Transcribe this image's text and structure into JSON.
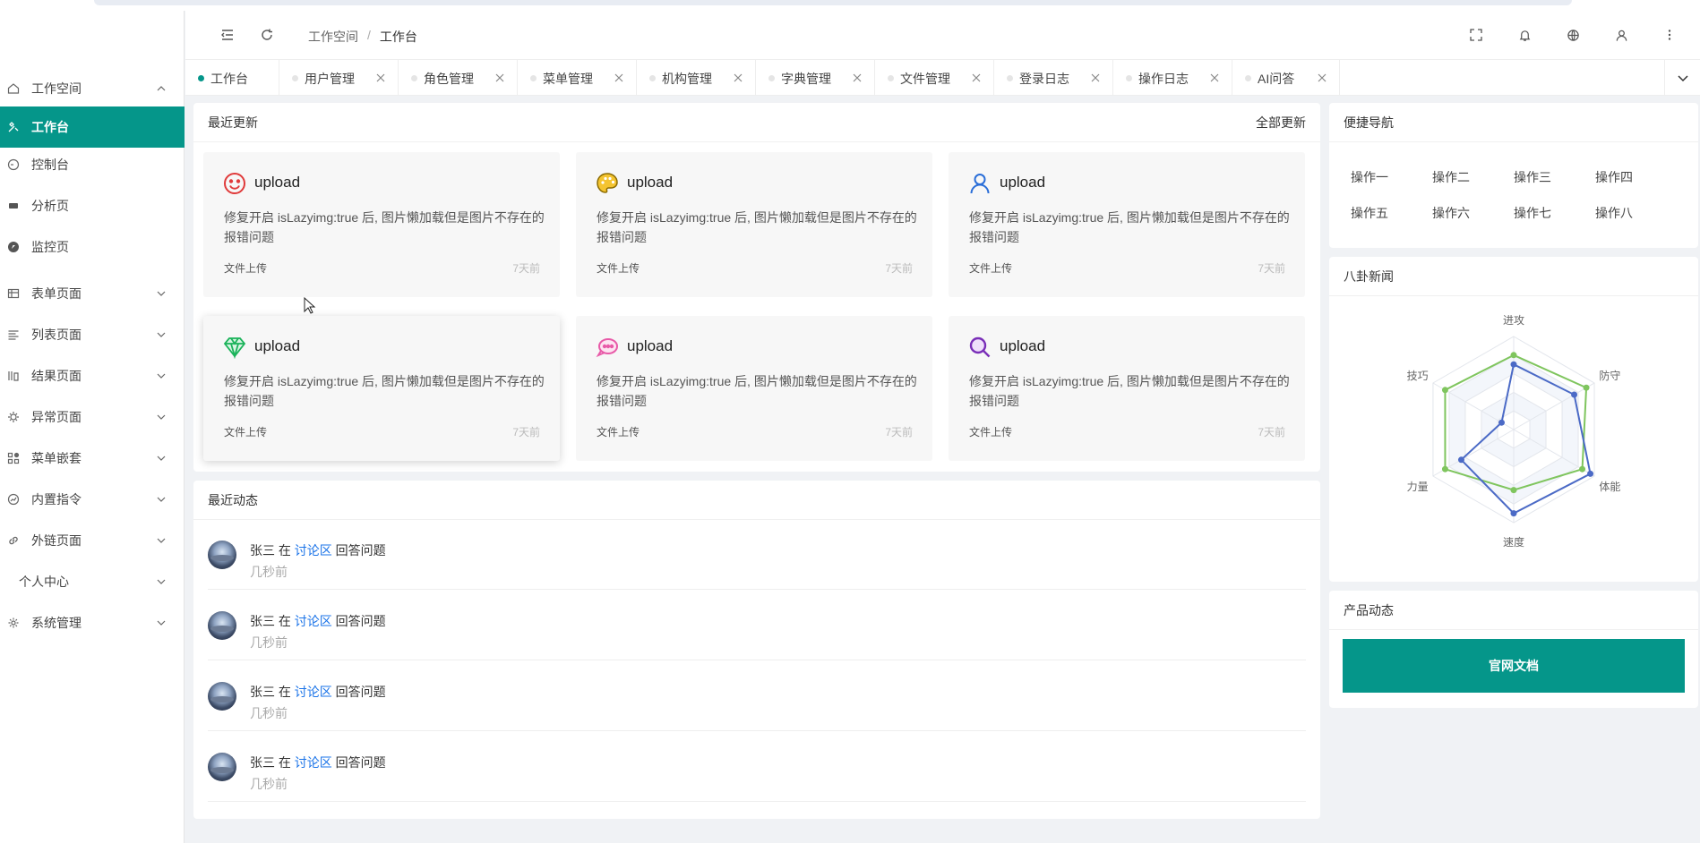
{
  "sidebar": {
    "items": [
      {
        "label": "工作空间",
        "icon": "home-icon",
        "arrow": "up"
      },
      {
        "label": "工作台",
        "icon": "workbench-icon",
        "active": true
      },
      {
        "label": "控制台",
        "icon": "console-icon"
      },
      {
        "label": "分析页",
        "icon": "analysis-icon"
      },
      {
        "label": "监控页",
        "icon": "monitor-icon"
      },
      {
        "label": "表单页面",
        "icon": "form-icon",
        "arrow": "down"
      },
      {
        "label": "列表页面",
        "icon": "list-icon",
        "arrow": "down"
      },
      {
        "label": "结果页面",
        "icon": "result-icon",
        "arrow": "down"
      },
      {
        "label": "异常页面",
        "icon": "exception-icon",
        "arrow": "down"
      },
      {
        "label": "菜单嵌套",
        "icon": "nested-menu-icon",
        "arrow": "down"
      },
      {
        "label": "内置指令",
        "icon": "directive-icon",
        "arrow": "down"
      },
      {
        "label": "外链页面",
        "icon": "external-link-icon",
        "arrow": "down"
      },
      {
        "label": "个人中心",
        "icon": "",
        "arrow": "down"
      },
      {
        "label": "系统管理",
        "icon": "settings-icon",
        "arrow": "down"
      }
    ]
  },
  "header": {
    "breadcrumb": [
      "工作空间",
      "工作台"
    ],
    "breadcrumb_sep": "/"
  },
  "tabs": [
    {
      "label": "工作台",
      "active": true,
      "closable": false
    },
    {
      "label": "用户管理",
      "closable": true
    },
    {
      "label": "角色管理",
      "closable": true
    },
    {
      "label": "菜单管理",
      "closable": true
    },
    {
      "label": "机构管理",
      "closable": true
    },
    {
      "label": "字典管理",
      "closable": true
    },
    {
      "label": "文件管理",
      "closable": true
    },
    {
      "label": "登录日志",
      "closable": true
    },
    {
      "label": "操作日志",
      "closable": true
    },
    {
      "label": "AI问答",
      "closable": true
    }
  ],
  "updates": {
    "title": "最近更新",
    "more": "全部更新",
    "items": [
      {
        "title": "upload",
        "icon": "smile-icon",
        "color": "#e03a3a",
        "desc": "修复开启 isLazyimg:true 后, 图片懒加载但是图片不存在的报错问题",
        "group": "文件上传",
        "time": "7天前"
      },
      {
        "title": "upload",
        "icon": "palette-icon",
        "color": "#f4c430",
        "desc": "修复开启 isLazyimg:true 后, 图片懒加载但是图片不存在的报错问题",
        "group": "文件上传",
        "time": "7天前"
      },
      {
        "title": "upload",
        "icon": "user-icon",
        "color": "#2a6ed8",
        "desc": "修复开启 isLazyimg:true 后, 图片懒加载但是图片不存在的报错问题",
        "group": "文件上传",
        "time": "7天前"
      },
      {
        "title": "upload",
        "icon": "diamond-icon",
        "color": "#1bb35a",
        "desc": "修复开启 isLazyimg:true 后, 图片懒加载但是图片不存在的报错问题",
        "group": "文件上传",
        "time": "7天前"
      },
      {
        "title": "upload",
        "icon": "chat-icon",
        "color": "#e85aa8",
        "desc": "修复开启 isLazyimg:true 后, 图片懒加载但是图片不存在的报错问题",
        "group": "文件上传",
        "time": "7天前"
      },
      {
        "title": "upload",
        "icon": "search-icon",
        "color": "#7a2fb8",
        "desc": "修复开启 isLazyimg:true 后, 图片懒加载但是图片不存在的报错问题",
        "group": "文件上传",
        "time": "7天前"
      }
    ]
  },
  "activity": {
    "title": "最近动态",
    "items": [
      {
        "user": "张三",
        "mid": "在",
        "link": "讨论区",
        "action": "回答问题",
        "time": "几秒前"
      },
      {
        "user": "张三",
        "mid": "在",
        "link": "讨论区",
        "action": "回答问题",
        "time": "几秒前"
      },
      {
        "user": "张三",
        "mid": "在",
        "link": "讨论区",
        "action": "回答问题",
        "time": "几秒前"
      },
      {
        "user": "张三",
        "mid": "在",
        "link": "讨论区",
        "action": "回答问题",
        "time": "几秒前"
      }
    ]
  },
  "quicknav": {
    "title": "便捷导航",
    "items": [
      "操作一",
      "操作二",
      "操作三",
      "操作四",
      "操作五",
      "操作六",
      "操作七",
      "操作八"
    ]
  },
  "gossip": {
    "title": "八卦新闻"
  },
  "product": {
    "title": "产品动态",
    "button": "官网文档"
  },
  "chart_data": {
    "type": "radar",
    "indicators": [
      "进攻",
      "防守",
      "体能",
      "速度",
      "力量",
      "技巧"
    ],
    "max": 100,
    "series": [
      {
        "color": "#7fc55e",
        "values": [
          80,
          90,
          85,
          65,
          85,
          85
        ]
      },
      {
        "color": "#4b6ac6",
        "values": [
          70,
          75,
          95,
          90,
          65,
          15
        ]
      }
    ]
  },
  "colors": {
    "accent": "#05968a",
    "link": "#1a73e8"
  }
}
